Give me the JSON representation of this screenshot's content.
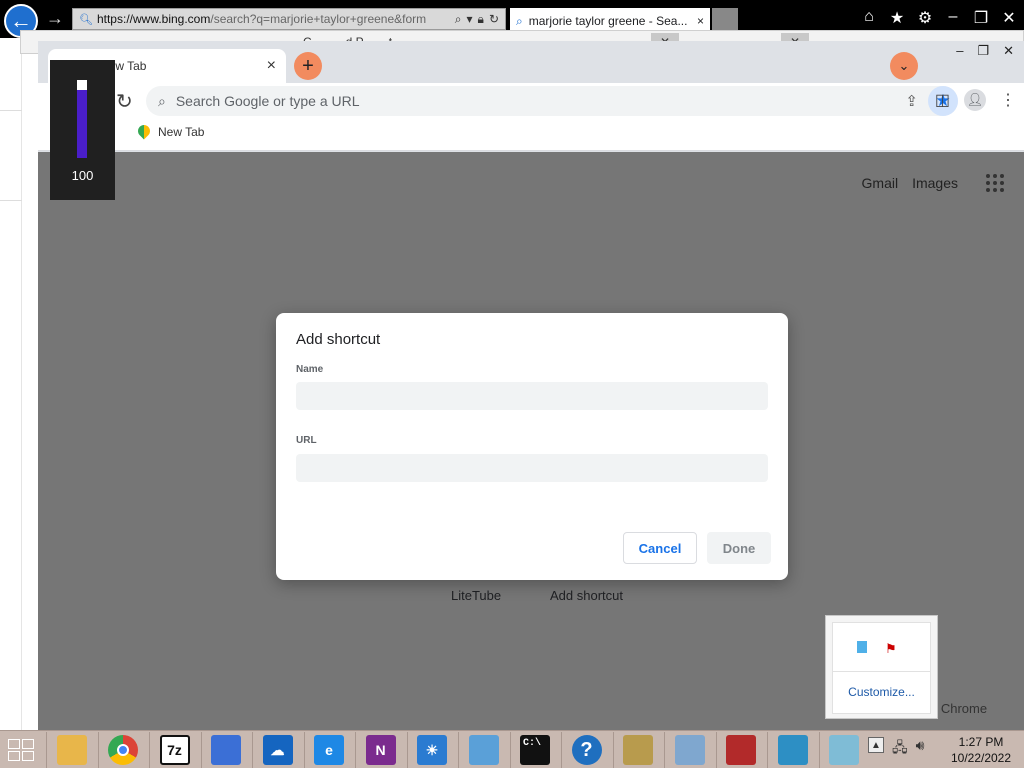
{
  "ie": {
    "url_main": "https://www.bing.com",
    "url_rest": "/search?q=marjorie+taylor+greene&form",
    "tab_title": "marjorie taylor greene - Sea..."
  },
  "background_window": {
    "title": "C... - ... d P... ... t"
  },
  "chrome": {
    "tab_title": "New Tab",
    "omnibox_placeholder": "Search Google or type a URL",
    "bookmark_left": "b",
    "bookmark_label": "New Tab",
    "ntp_links": [
      "Gmail",
      "Images"
    ],
    "tiles": [
      "LiteTube",
      "Add shortcut"
    ]
  },
  "meter": {
    "value": "100",
    "level": 1.0,
    "color": "#4a1ec9"
  },
  "dialog": {
    "title": "Add shortcut",
    "name_label": "Name",
    "name_value": "",
    "url_label": "URL",
    "url_value": "",
    "cancel_label": "Cancel",
    "done_label": "Done"
  },
  "tray_popup": {
    "customize_label": "Customize..."
  },
  "chrome_partial_label": "e Chrome",
  "taskbar": {
    "apps": [
      {
        "name": "file-explorer",
        "glyph": "",
        "color": "#e8b64a"
      },
      {
        "name": "chrome",
        "glyph": "",
        "color": "#dc4437"
      },
      {
        "name": "7zip",
        "glyph": "7z",
        "color": "#111111"
      },
      {
        "name": "security-shield",
        "glyph": "",
        "color": "#3b6fd6"
      },
      {
        "name": "onedrive",
        "glyph": "☁",
        "color": "#1565c0"
      },
      {
        "name": "internet-explorer",
        "glyph": "e",
        "color": "#1e88e5"
      },
      {
        "name": "onenote",
        "glyph": "N",
        "color": "#7b2b8e"
      },
      {
        "name": "brightness",
        "glyph": "☀",
        "color": "#2a7bd1"
      },
      {
        "name": "control-panel",
        "glyph": "",
        "color": "#5aa0d8"
      },
      {
        "name": "command-prompt",
        "glyph": "C:\\",
        "color": "#111111"
      },
      {
        "name": "help",
        "glyph": "?",
        "color": "#1f6fbf"
      },
      {
        "name": "keys",
        "glyph": "",
        "color": "#b89b4d"
      },
      {
        "name": "performance-monitor",
        "glyph": "",
        "color": "#7fa7cf"
      },
      {
        "name": "news",
        "glyph": "",
        "color": "#b22a2a"
      },
      {
        "name": "photos",
        "glyph": "",
        "color": "#2d8fc4"
      },
      {
        "name": "notepad",
        "glyph": "",
        "color": "#7fbcd6"
      }
    ],
    "time": "1:27 PM",
    "date": "10/22/2022"
  }
}
